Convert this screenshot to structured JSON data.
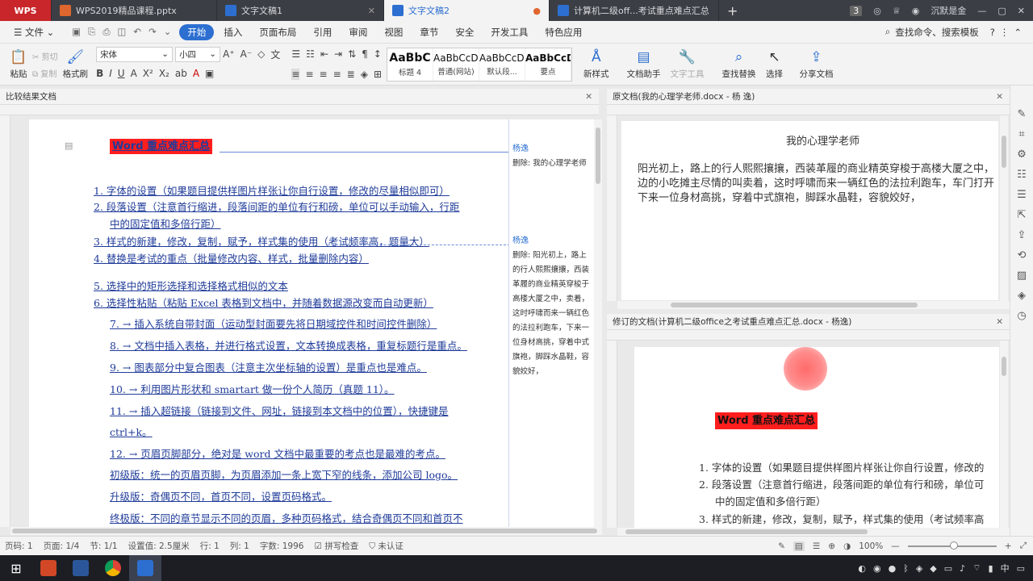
{
  "tabs": {
    "wps": "WPS",
    "tab1": "WPS2019精品课程.pptx",
    "tab2": "文字文稿1",
    "tab3": "文字文稿2",
    "tab4": "计算机二级off...考试重点难点汇总",
    "add": "+",
    "badge": "3",
    "user": "沉默是金"
  },
  "menu": {
    "file": "文件",
    "start": "开始",
    "items": [
      "插入",
      "页面布局",
      "引用",
      "审阅",
      "视图",
      "章节",
      "安全",
      "开发工具",
      "特色应用"
    ],
    "search": "查找命令、搜索模板"
  },
  "ribbon": {
    "paste": "粘贴",
    "cut": "剪切",
    "copy": "复制",
    "format_painter": "格式刷",
    "font": "宋体",
    "size": "小四",
    "styles": [
      {
        "sample": "AaBbC",
        "name": "标题 4"
      },
      {
        "sample": "AaBbCcDd",
        "name": "普通(网站)"
      },
      {
        "sample": "AaBbCcDd",
        "name": "默认段..."
      },
      {
        "sample": "AaBbCcDd",
        "name": "要点"
      }
    ],
    "new_style": "新样式",
    "doc_helper": "文档助手",
    "text_tools": "文字工具",
    "find_replace": "查找替换",
    "select": "选择",
    "share": "分享文档"
  },
  "panes": {
    "compare_title": "比较结果文档",
    "original_title": "原文档(我的心理学老师.docx - 杨 逸)",
    "revised_title": "修订的文档(计算机二级office之考试重点难点汇总.docx - 杨逸)"
  },
  "compare": {
    "heading": "Word 重点难点汇总",
    "lines": [
      "1. 字体的设置（如果题目提供样图片样张让你自行设置，修改的尽量相似即可）",
      "2. 段落设置（注意首行缩进，段落间距的单位有行和磅，单位可以手动输入，行距",
      "中的固定值和多倍行距）",
      "3. 样式的新建，修改，复制，赋予，样式集的使用（考试频率高，题量大）",
      "4. 替换是考试的重点（批量修改内容、样式，批量删除内容）",
      "5. 选择中的矩形选择和选择格式相似的文本",
      "6. 选择性粘贴（粘贴 Excel 表格到文档中，并随着数据源改变而自动更新）",
      "7. → 插入系统自带封面（运动型封面要先将日期域控件和时间控件删除）",
      "8. → 文档中插入表格，并进行格式设置，文本转换成表格，重复标题行是重点。",
      "9. → 图表部分中复合图表（注意主次坐标轴的设置）是重点也是难点。",
      "10. → 利用图片形状和 smartart 做一份个人简历（真题 11）。",
      "11. → 插入超链接（链接到文件、网址，链接到本文档中的位置），快捷键是",
      "ctrl+k。",
      "12. → 页眉页脚部分，绝对是 word 文档中最重要的考点也是最难的考点。",
      "初级版：统一的页眉页脚，为页眉添加一条上宽下窄的线条，添加公司 logo。",
      "升级版：奇偶页不同，首页不同，设置页码格式。",
      "终极版：不同的章节显示不同的页眉，多种页码格式，结合奇偶页不同和首页不"
    ]
  },
  "comments": [
    {
      "author": "杨逸",
      "text": "删除: 我的心理学老师"
    },
    {
      "author": "杨逸",
      "text": "删除: 阳光初上，路上的行人熙熙攘攘，西装革履的商业精英穿梭于高楼大厦之中，卖着，这时呼啸而来一辆红色的法拉利跑车，下来一位身材高挑，穿着中式旗袍，脚踩水晶鞋，容貌姣好，"
    }
  ],
  "original": {
    "title": "我的心理学老师",
    "para": [
      "阳光初上，路上的行人熙熙攘攘，西装革履的商业精英穿梭于高楼大厦之中，",
      "边的小吃摊主尽情的叫卖着，这时呼啸而来一辆红色的法拉利跑车，车门打开",
      "下来一位身材高挑，穿着中式旗袍，脚踩水晶鞋，容貌姣好，"
    ]
  },
  "revised": {
    "heading": "Word 重点难点汇总",
    "lines": [
      "1. 字体的设置（如果题目提供样图片样张让你自行设置，修改的",
      "2. 段落设置（注意首行缩进，段落间距的单位有行和磅，单位可",
      "中的固定值和多倍行距）",
      "3. 样式的新建，修改，复制，赋予，样式集的使用（考试频率高"
    ]
  },
  "status": {
    "page_num": "页码: 1",
    "pages": "页面: 1/4",
    "section": "节: 1/1",
    "setting": "设置值: 2.5厘米",
    "row": "行: 1",
    "col": "列: 1",
    "words": "字数: 1996",
    "spell": "拼写检查",
    "cert": "未认证",
    "zoom": "100%"
  },
  "taskbar": {
    "ime": "中"
  },
  "colors": {
    "accent": "#2c6fd1",
    "revision": "#1f3b99",
    "highlight": "#ff1e1e"
  }
}
